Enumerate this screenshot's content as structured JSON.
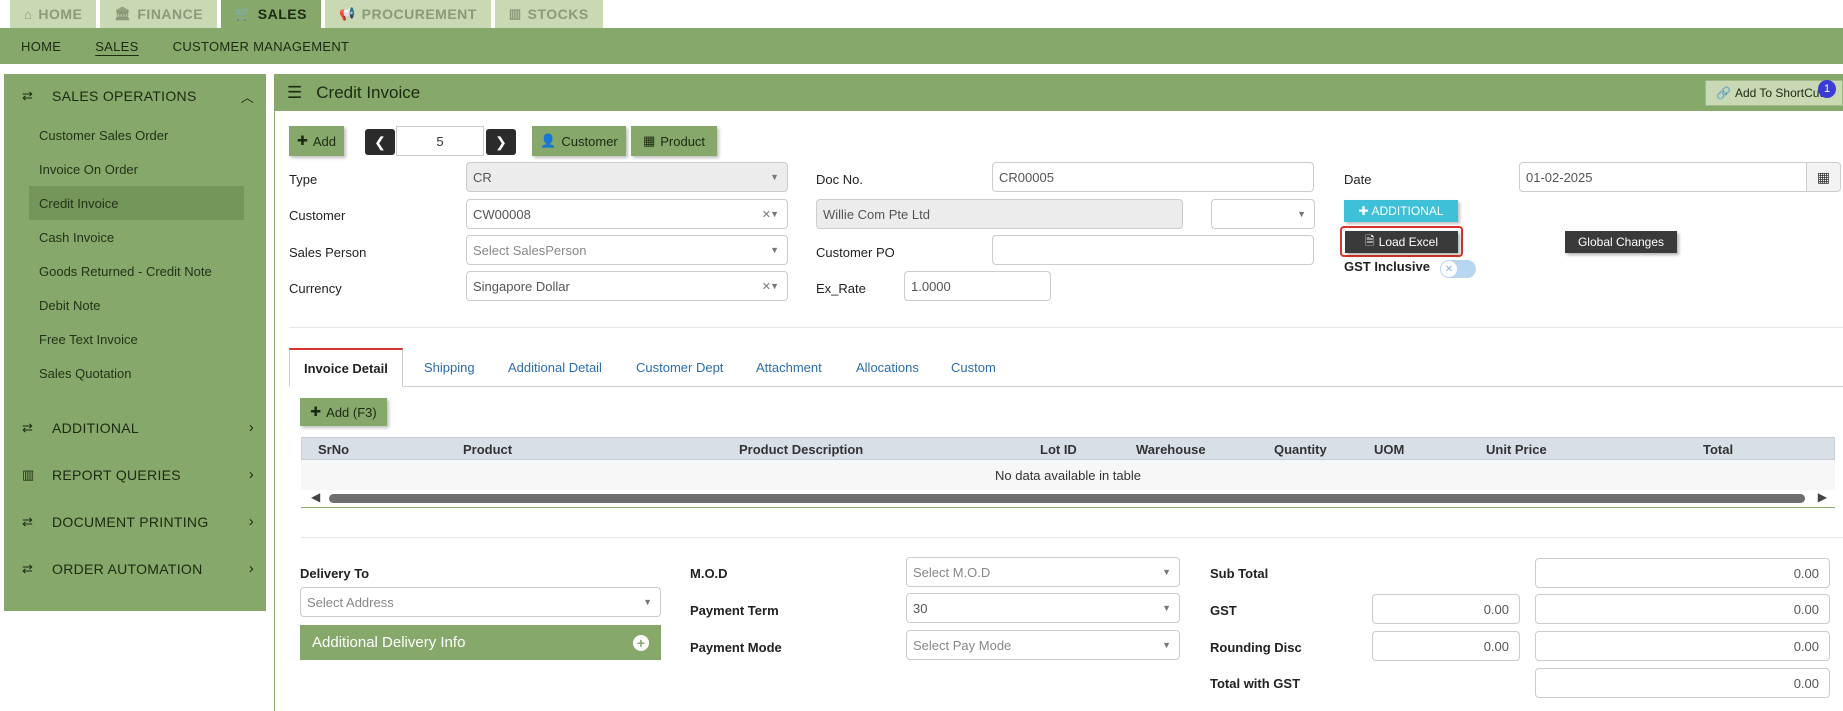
{
  "top_tabs": [
    {
      "icon": "home-icon",
      "label": "HOME"
    },
    {
      "icon": "bank-icon",
      "label": "FINANCE"
    },
    {
      "icon": "cart-icon",
      "label": "SALES"
    },
    {
      "icon": "megaphone-icon",
      "label": "PROCUREMENT"
    },
    {
      "icon": "bar-chart-icon",
      "label": "STOCKS"
    }
  ],
  "sub_nav": [
    "HOME",
    "SALES",
    "CUSTOMER MANAGEMENT"
  ],
  "sidebar": {
    "section": "SALES OPERATIONS",
    "items": [
      "Customer Sales Order",
      "Invoice On Order",
      "Credit Invoice",
      "Cash Invoice",
      "Goods Returned - Credit Note",
      "Debit Note",
      "Free Text Invoice",
      "Sales Quotation"
    ],
    "groups": [
      "ADDITIONAL",
      "REPORT QUERIES",
      "DOCUMENT PRINTING",
      "ORDER AUTOMATION"
    ]
  },
  "header": {
    "title": "Credit Invoice",
    "shortcut_label": "Add To ShortCut",
    "shortcut_badge": "1"
  },
  "toolbar": {
    "add_label": "Add",
    "record_number": "5",
    "customer_label": "Customer",
    "product_label": "Product"
  },
  "form": {
    "type_label": "Type",
    "type_value": "CR",
    "customer_label": "Customer",
    "customer_value": "CW00008",
    "customer_name": "Willie Com Pte Ltd",
    "sales_person_label": "Sales Person",
    "sales_person_placeholder": "Select SalesPerson",
    "currency_label": "Currency",
    "currency_value": "Singapore Dollar",
    "doc_no_label": "Doc No.",
    "doc_no_value": "CR00005",
    "customer_po_label": "Customer PO",
    "customer_po_value": "",
    "ex_rate_label": "Ex_Rate",
    "ex_rate_value": "1.0000",
    "date_label": "Date",
    "date_value": "01-02-2025",
    "additional_button": "ADDITIONAL",
    "load_excel_button": "Load Excel",
    "global_changes_button": "Global Changes",
    "gst_inclusive_label": "GST Inclusive"
  },
  "tabs": [
    "Invoice Detail",
    "Shipping",
    "Additional Detail",
    "Customer Dept",
    "Attachment",
    "Allocations",
    "Custom"
  ],
  "detail": {
    "add_button": "Add (F3)",
    "columns": [
      "SrNo",
      "Product",
      "Product Description",
      "Lot ID",
      "Warehouse",
      "Quantity",
      "UOM",
      "Unit Price",
      "Total"
    ],
    "empty_message": "No data available in table"
  },
  "footer": {
    "delivery_to_label": "Delivery To",
    "address_placeholder": "Select Address",
    "additional_delivery_info": "Additional Delivery Info",
    "mod_label": "M.O.D",
    "mod_placeholder": "Select M.O.D",
    "payment_term_label": "Payment Term",
    "payment_term_value": "30",
    "payment_mode_label": "Payment Mode",
    "payment_mode_placeholder": "Select Pay Mode",
    "sub_total_label": "Sub Total",
    "sub_total_value": "0.00",
    "gst_label": "GST",
    "gst_rate_value": "0.00",
    "gst_value": "0.00",
    "rounding_disc_label": "Rounding Disc",
    "rounding_input_value": "0.00",
    "rounding_value": "0.00",
    "total_with_gst_label": "Total with GST",
    "total_with_gst_value": "0.00"
  }
}
